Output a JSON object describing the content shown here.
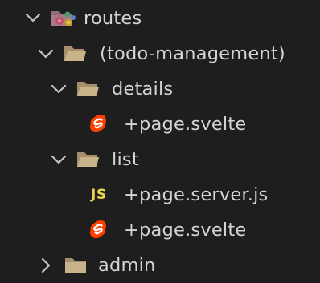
{
  "explorer": {
    "items": [
      {
        "label": "routes",
        "type": "folder",
        "expanded": true,
        "icon": "routes-folder-icon"
      },
      {
        "label": "(todo-management)",
        "type": "folder",
        "expanded": true,
        "icon": "folder-icon"
      },
      {
        "label": "details",
        "type": "folder",
        "expanded": true,
        "icon": "folder-icon"
      },
      {
        "label": "+page.svelte",
        "type": "file",
        "icon": "svelte-icon"
      },
      {
        "label": "list",
        "type": "folder",
        "expanded": true,
        "icon": "folder-icon"
      },
      {
        "label": "+page.server.js",
        "type": "file",
        "icon": "js-icon",
        "icon_text": "JS"
      },
      {
        "label": "+page.svelte",
        "type": "file",
        "icon": "svelte-icon"
      },
      {
        "label": "admin",
        "type": "folder",
        "expanded": false,
        "icon": "folder-icon"
      }
    ]
  },
  "colors": {
    "background": "#1e1e1e",
    "text": "#d4d4d4",
    "chevron": "#c5c5c5",
    "folder": "#c9b38a",
    "svelte": "#ff3e00",
    "js": "#e8d44d"
  }
}
